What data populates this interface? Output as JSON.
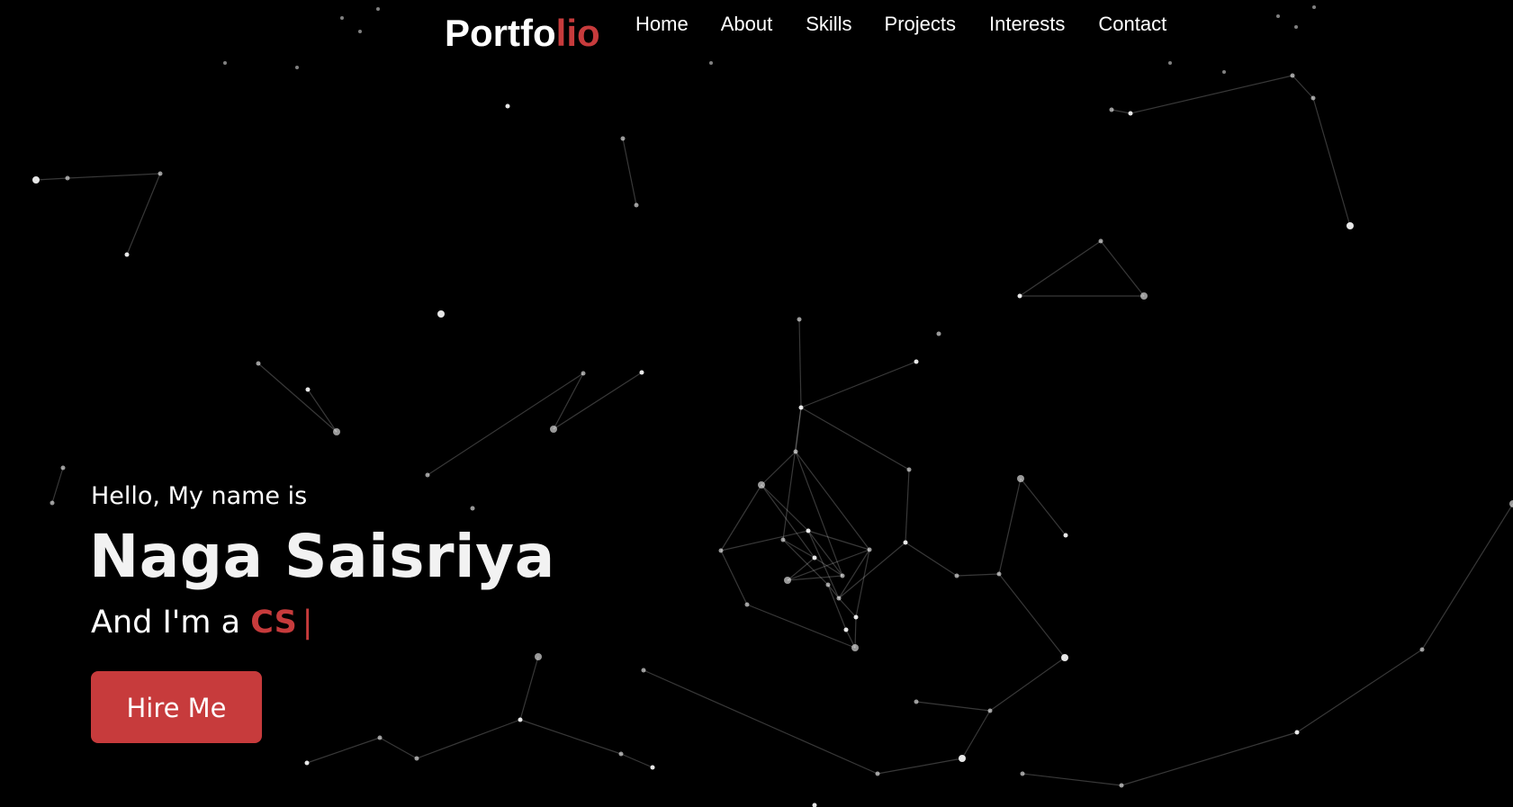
{
  "logo": {
    "main": "Portfo",
    "accent": "lio"
  },
  "nav": {
    "items": [
      {
        "label": "Home"
      },
      {
        "label": "About"
      },
      {
        "label": "Skills"
      },
      {
        "label": "Projects"
      },
      {
        "label": "Interests"
      },
      {
        "label": "Contact"
      }
    ]
  },
  "hero": {
    "greeting": "Hello, My name is",
    "name": "Naga Saisriya",
    "role_prefix": "And I'm a",
    "role_typed": "CS",
    "cursor": "|",
    "cta_label": "Hire Me"
  },
  "colors": {
    "background": "#000000",
    "accent": "#c73b3c",
    "text": "#ffffff",
    "particle": "#ffffff"
  },
  "background": {
    "icon": "particle-network"
  }
}
